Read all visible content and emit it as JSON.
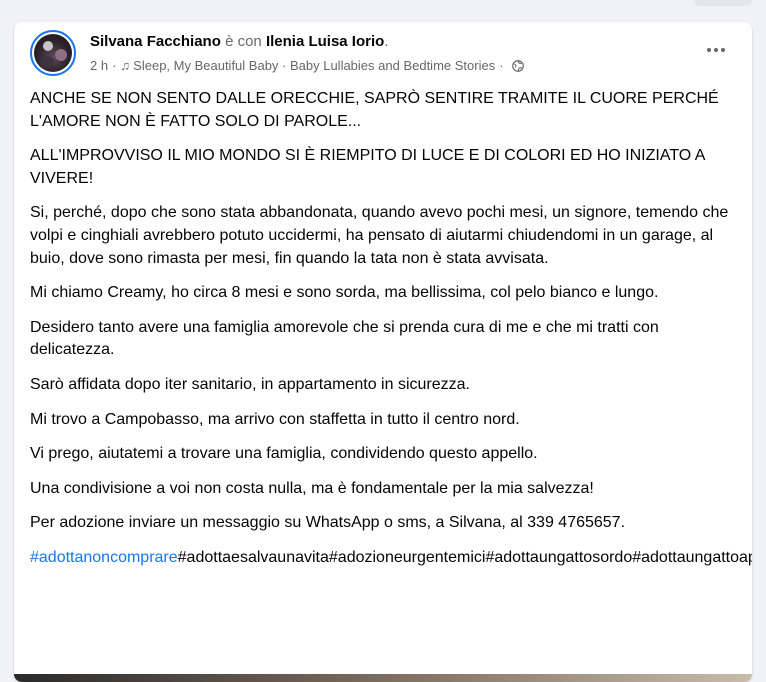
{
  "post": {
    "author": "Silvana Facchiano",
    "connector": "è con",
    "with_name": "Ilenia Luisa Iorio",
    "with_suffix": ".",
    "time": "2 h",
    "separator": "·",
    "audio_title": "Sleep, My Beautiful Baby · Baby Lullabies and Bedtime Stories",
    "audience_icon": "globe-icon",
    "more_icon": "more-horizontal-icon",
    "paragraphs": [
      "ANCHE SE NON SENTO DALLE ORECCHIE, SAPRÒ SENTIRE TRAMITE IL CUORE PERCHÉ L'AMORE NON È FATTO SOLO DI PAROLE...",
      "ALL'IMPROVVISO IL MIO MONDO SI È RIEMPITO DI LUCE E DI COLORI ED HO INIZIATO A VIVERE!",
      "Si, perché, dopo che sono stata abbandonata, quando avevo pochi mesi, un signore, temendo che volpi e cinghiali avrebbero potuto uccidermi, ha pensato di aiutarmi chiudendomi in un garage, al buio, dove sono rimasta per mesi, fin quando la tata non è stata avvisata.",
      "Mi chiamo Creamy, ho circa 8 mesi e sono sorda, ma bellissima, col pelo bianco e lungo.",
      "Desidero tanto avere una famiglia amorevole che si prenda cura di me e che mi tratti con delicatezza.",
      "Sarò affidata dopo iter sanitario, in appartamento in sicurezza.",
      "Mi trovo a Campobasso, ma arrivo con staffetta in tutto il centro nord.",
      "Vi prego, aiutatemi a trovare una famiglia, condividendo questo appello.",
      "Una condivisione a voi non costa nulla, ma è fondamentale per la mia salvezza!",
      "Per adozione inviare un messaggio su WhatsApp o sms, a Silvana, al 339 4765657."
    ],
    "hashtags": [
      "#adottanoncomprare",
      "#adottaesalvaunavita",
      "#adozioneurgentemici",
      "#adottaungattosordo",
      "#adottaungattoapelolungo"
    ]
  },
  "colors": {
    "link": "#1877f2",
    "secondary_text": "#65676b",
    "background": "#f0f2f5"
  }
}
